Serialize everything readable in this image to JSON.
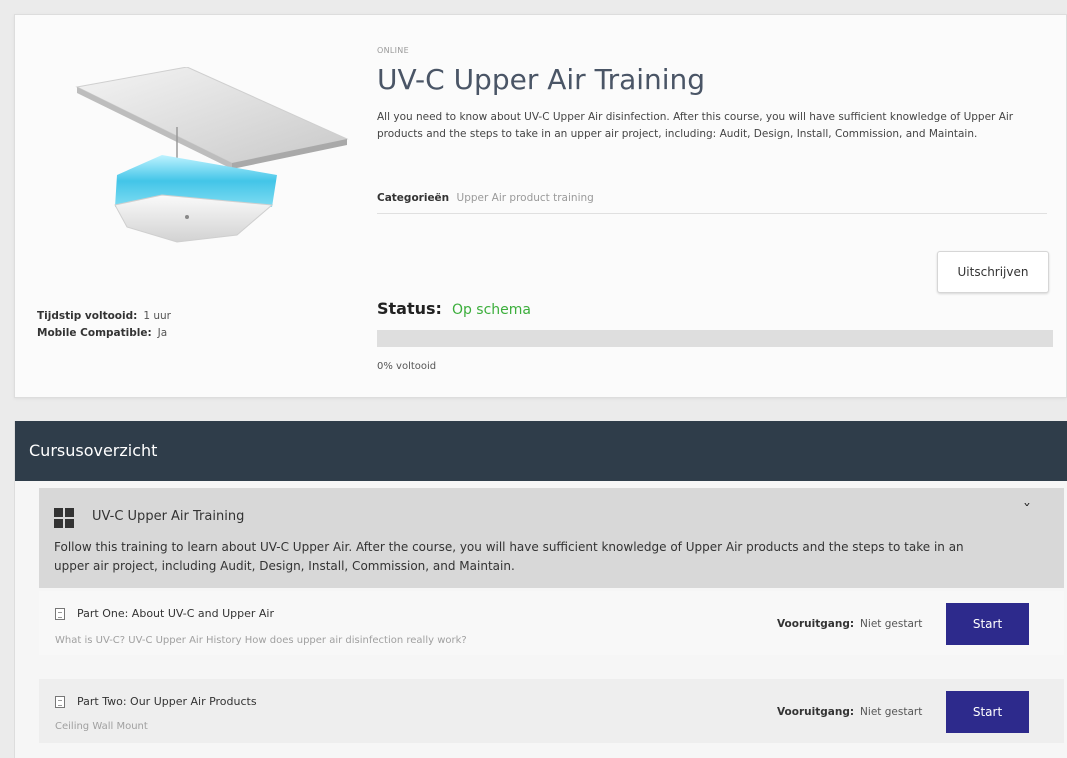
{
  "course": {
    "badge": "ONLINE",
    "title": "UV-C Upper Air Training",
    "description": "All you need to know about UV-C Upper Air disinfection. After this course, you will have sufficient knowledge of Upper Air products and the steps to take in an upper air project, including: Audit, Design, Install, Commission, and Maintain.",
    "categories_label": "Categorieën",
    "categories_value": "Upper Air product training",
    "unenroll_label": "Uitschrijven",
    "status_label": "Status:",
    "status_value": "Op schema",
    "status_color": "#3cae3c",
    "progress_percent": 0,
    "progress_text": "0% voltooid",
    "completion_time_label": "Tijdstip voltooid:",
    "completion_time_value": "1 uur",
    "mobile_label": "Mobile Compatible:",
    "mobile_value": "Ja"
  },
  "overview": {
    "header": "Cursusoverzicht",
    "module": {
      "title": "UV-C Upper Air Training",
      "description": "Follow this training to learn about UV-C Upper Air. After the course, you will have sufficient knowledge of Upper Air products and the steps to take in an upper air project, including Audit, Design, Install, Commission, and Maintain.",
      "icon": "grid-icon",
      "toggle_icon": "chevron-down-icon"
    },
    "lessons": [
      {
        "title": "Part One: About UV-C and Upper Air",
        "subtitle": "What is UV-C? UV-C Upper Air History How does upper air disinfection really work?",
        "progress_label": "Vooruitgang:",
        "progress_value": "Niet gestart",
        "button_label": "Start"
      },
      {
        "title": "Part Two: Our Upper Air Products",
        "subtitle": "Ceiling Wall Mount",
        "progress_label": "Vooruitgang:",
        "progress_value": "Niet gestart",
        "button_label": "Start"
      }
    ]
  },
  "colors": {
    "header_bg": "#2f3d4a",
    "button_bg": "#2d2a8c",
    "module_bg": "#d8d8d8"
  }
}
